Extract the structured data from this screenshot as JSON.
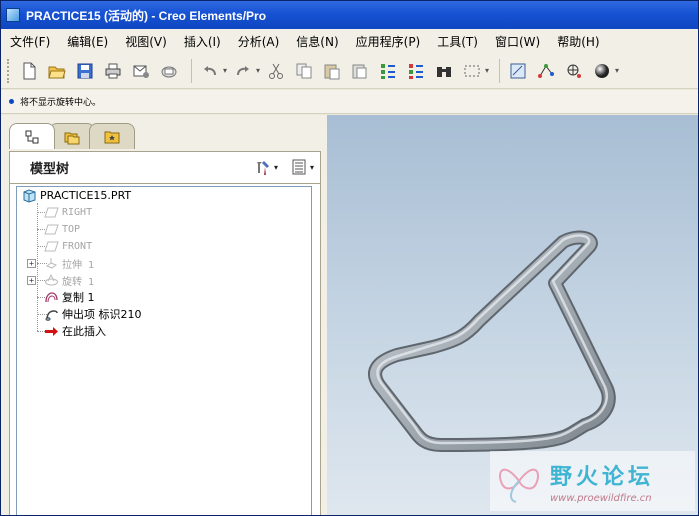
{
  "window": {
    "title": "PRACTICE15 (活动的) - Creo Elements/Pro"
  },
  "menubar": {
    "items": [
      {
        "label": "文件(F)"
      },
      {
        "label": "编辑(E)"
      },
      {
        "label": "视图(V)"
      },
      {
        "label": "插入(I)"
      },
      {
        "label": "分析(A)"
      },
      {
        "label": "信息(N)"
      },
      {
        "label": "应用程序(P)"
      },
      {
        "label": "工具(T)"
      },
      {
        "label": "窗口(W)"
      },
      {
        "label": "帮助(H)"
      }
    ]
  },
  "toolbar": {
    "icons": [
      "new-file-icon",
      "open-folder-icon",
      "save-icon",
      "print-icon",
      "send-mail-icon",
      "mail-icon",
      "undo-icon",
      "redo-icon",
      "cut-icon",
      "copy-icon",
      "paste-icon",
      "paste-special-icon",
      "regenerate-icon",
      "regen-manager-icon",
      "find-icon",
      "select-box-icon",
      "view-manager-icon",
      "datum-point-icon",
      "spin-center-icon",
      "render-sphere-icon"
    ]
  },
  "message": {
    "text": "将不显示旋转中心。"
  },
  "panel": {
    "tabs": [
      "model-tree-tab-icon",
      "folder-browser-tab-icon",
      "favorites-tab-icon"
    ],
    "title": "模型树"
  },
  "tree": {
    "root": "PRACTICE15.PRT",
    "items": [
      {
        "label": "RIGHT",
        "icon": "datum-plane-icon",
        "dim": true
      },
      {
        "label": "TOP",
        "icon": "datum-plane-icon",
        "dim": true
      },
      {
        "label": "FRONT",
        "icon": "datum-plane-icon",
        "dim": true
      },
      {
        "label": "拉伸 1",
        "icon": "extrude-icon",
        "dim": true,
        "expandable": true
      },
      {
        "label": "旋转 1",
        "icon": "revolve-icon",
        "dim": true,
        "expandable": true
      },
      {
        "label": "复制 1",
        "icon": "copy-feature-icon",
        "dim": false
      },
      {
        "label": "伸出项 标识210",
        "icon": "sweep-protrusion-icon",
        "dim": false
      },
      {
        "label": "在此插入",
        "icon": "insert-here-arrow-icon",
        "dim": false
      }
    ]
  },
  "watermark": {
    "title": "野火论坛",
    "url": "www.proewildfire.cn"
  },
  "colors": {
    "title_bar": "#1652d3",
    "viewport_top": "#a8bed4",
    "viewport_bottom": "#dfe7ef",
    "model": "#9aa3ab",
    "insert_arrow": "#d41010"
  }
}
